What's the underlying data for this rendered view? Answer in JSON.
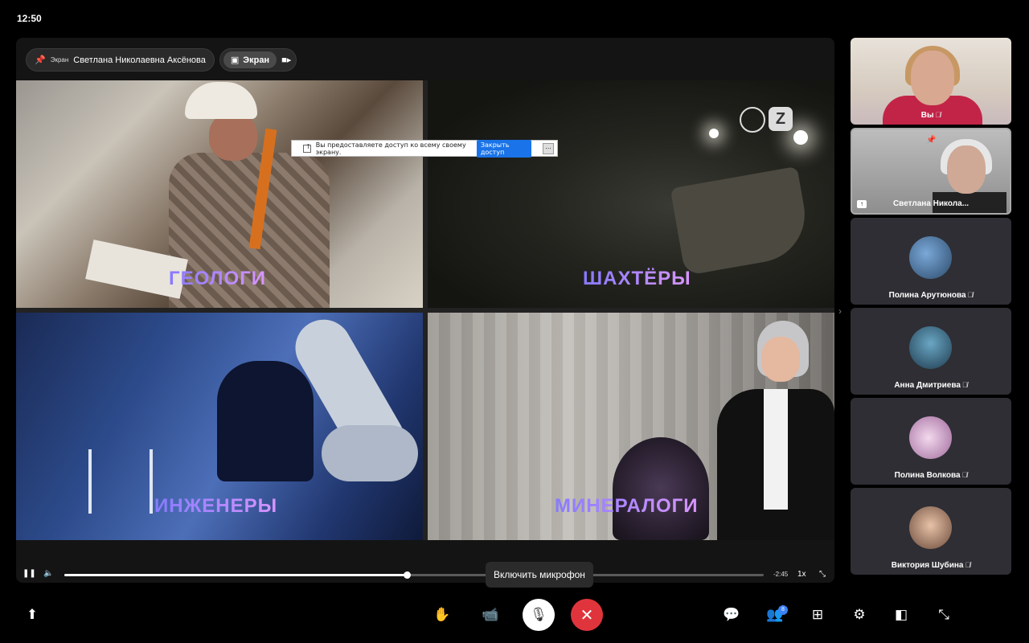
{
  "status": {
    "time": "12:50"
  },
  "stage": {
    "presenter_pill": {
      "small_label": "Экран",
      "name": "Светлана Николаевна Аксёнова"
    },
    "screen_pill": {
      "label": "Экран"
    }
  },
  "video": {
    "tiles": [
      {
        "label": "ГЕОЛОГИ"
      },
      {
        "label": "ШАХТЁРЫ"
      },
      {
        "label": "ИНЖЕНЕРЫ"
      },
      {
        "label": "МИНЕРАЛОГИ"
      }
    ],
    "share_notice": {
      "text": "Вы предоставляете доступ ко всему своему экрану.",
      "close_button": "Закрыть доступ",
      "minimize": "..."
    },
    "player": {
      "remaining": "-2:45",
      "speed": "1x",
      "progress": 0.49
    }
  },
  "participants": [
    {
      "name": "Вы"
    },
    {
      "name": "Светлана Никола..."
    },
    {
      "name": "Полина Арутюнова"
    },
    {
      "name": "Анна Дмитриева"
    },
    {
      "name": "Полина Волкова"
    },
    {
      "name": "Виктория Шубина"
    }
  ],
  "toolbar": {
    "tooltip": "Включить микрофон",
    "participants_badge": "8"
  },
  "colors": {
    "end_call": "#e0343c",
    "accent": "#3b82f6",
    "label_from": "#7b6cff",
    "label_to": "#d58bff"
  }
}
